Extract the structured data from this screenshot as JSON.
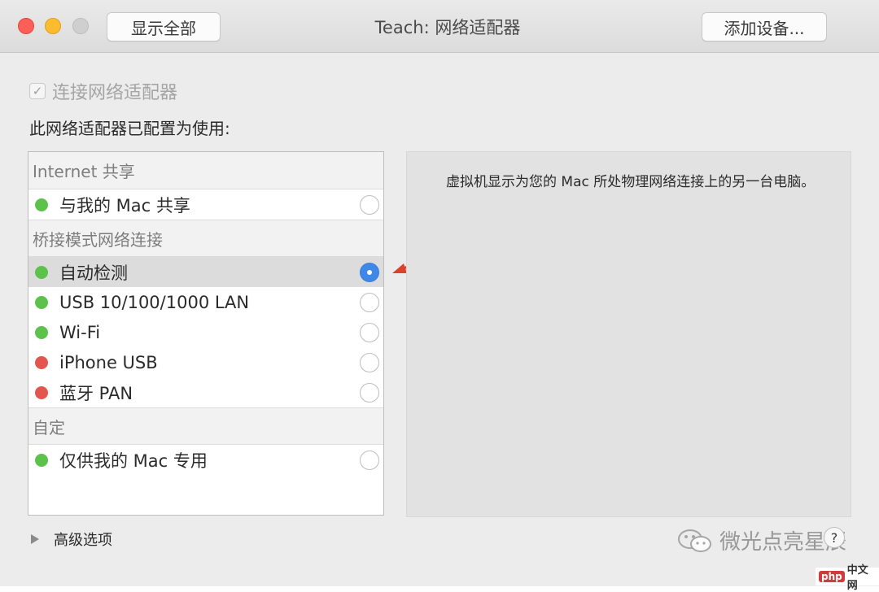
{
  "window": {
    "title": "Teach: 网络适配器",
    "buttons": {
      "show_all": "显示全部",
      "add_device": "添加设备..."
    }
  },
  "connect": {
    "label": "连接网络适配器",
    "checked": true
  },
  "configured_label": "此网络适配器已配置为使用:",
  "list": {
    "sections": [
      {
        "header": "Internet 共享",
        "items": [
          {
            "label": "与我的 Mac 共享",
            "status": "green",
            "selected": false
          }
        ]
      },
      {
        "header": "桥接模式网络连接",
        "items": [
          {
            "label": "自动检测",
            "status": "green",
            "selected": true
          },
          {
            "label": "USB 10/100/1000 LAN",
            "status": "green",
            "selected": false
          },
          {
            "label": "Wi-Fi",
            "status": "green",
            "selected": false
          },
          {
            "label": "iPhone USB",
            "status": "red",
            "selected": false
          },
          {
            "label": "蓝牙 PAN",
            "status": "red",
            "selected": false
          }
        ]
      },
      {
        "header": "自定",
        "items": [
          {
            "label": "仅供我的 Mac 专用",
            "status": "green",
            "selected": false
          }
        ]
      }
    ]
  },
  "description": "虚拟机显示为您的 Mac 所处物理网络连接上的另一台电脑。",
  "advanced_label": "高级选项",
  "help_label": "?",
  "watermark": {
    "text": "微光点亮星辰"
  },
  "site_badge": {
    "php": "php",
    "cn": "中文网"
  },
  "colors": {
    "green": "#5cc24c",
    "red": "#e5554f",
    "accent": "#3f88e8",
    "arrow": "#d9432e"
  }
}
